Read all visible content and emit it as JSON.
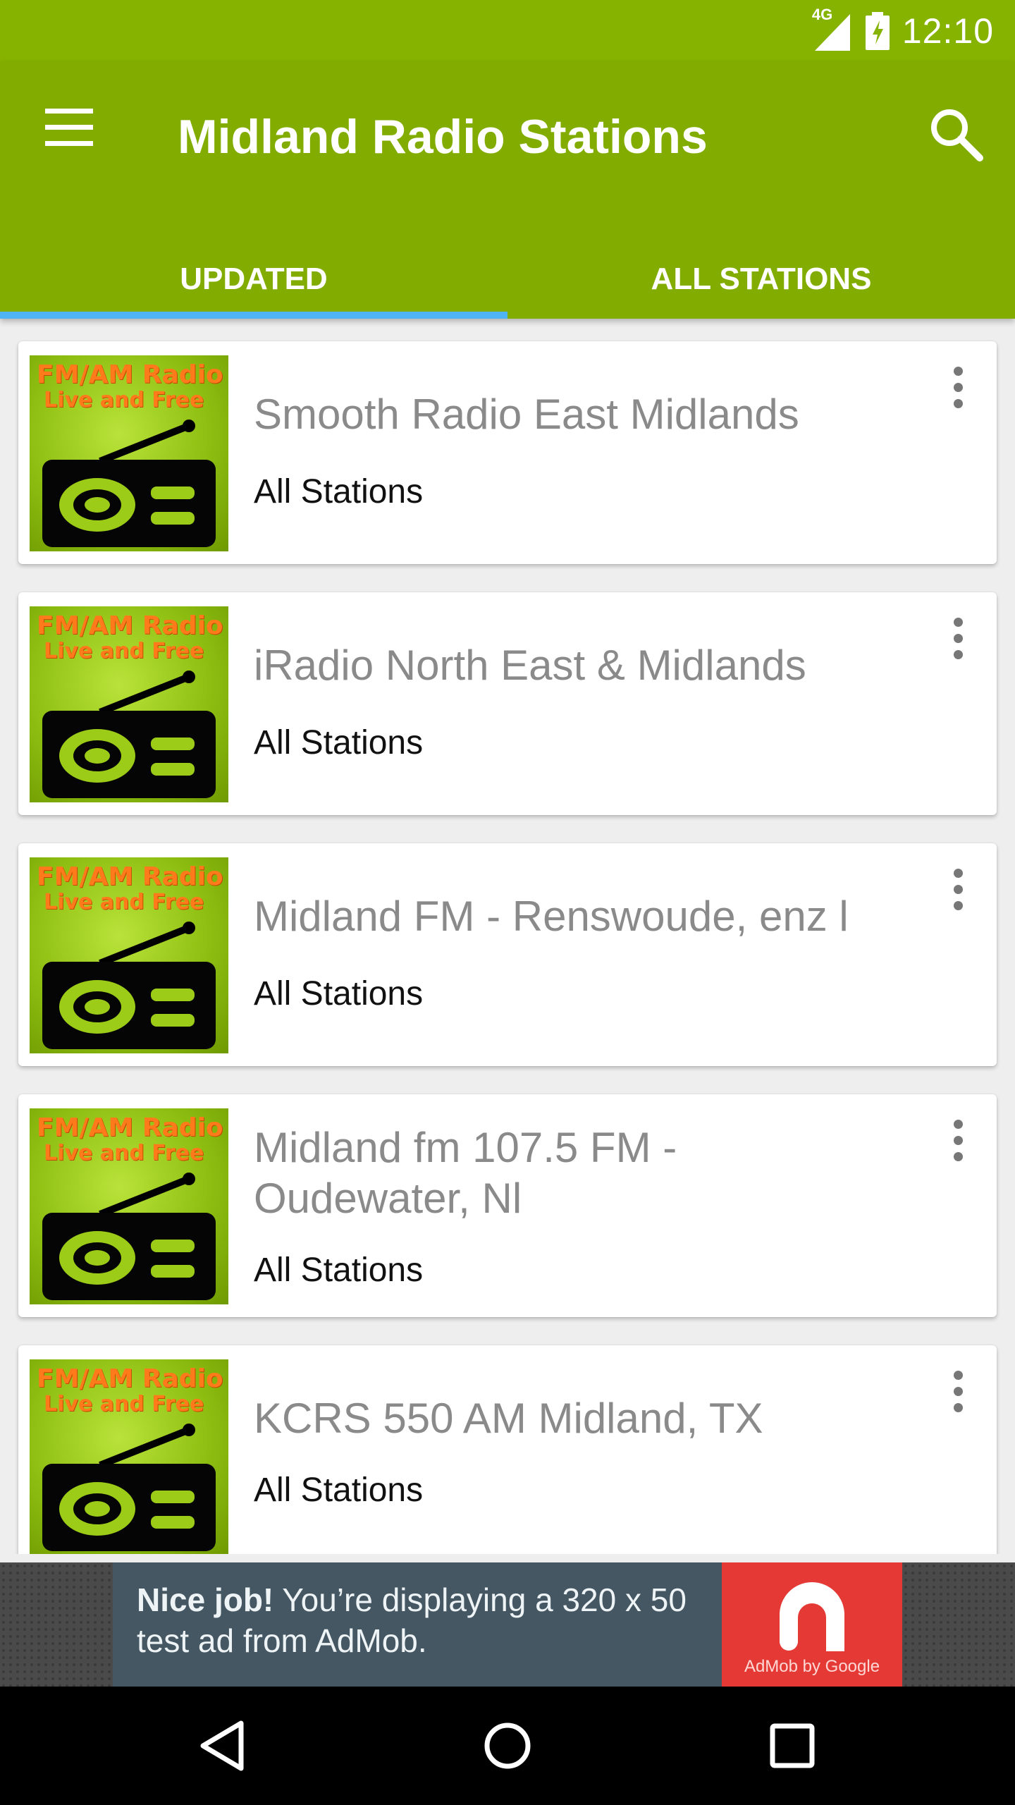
{
  "status_bar": {
    "network": "4G",
    "time": "12:10"
  },
  "app_bar": {
    "title": "Midland Radio Stations",
    "menu_icon": "hamburger-menu-icon",
    "search_icon": "search-icon",
    "background_color": "#82ad00",
    "accent_color": "#4fb4f4"
  },
  "tabs": [
    {
      "label": "UPDATED",
      "selected": true
    },
    {
      "label": "ALL STATIONS",
      "selected": false
    }
  ],
  "stations": [
    {
      "title": "Smooth Radio East Midlands",
      "subtitle": "All Stations",
      "thumb_line1": "FM/AM Radio",
      "thumb_line2": "Live and Free"
    },
    {
      "title": "iRadio North East & Midlands",
      "subtitle": "All Stations",
      "thumb_line1": "FM/AM Radio",
      "thumb_line2": "Live and Free"
    },
    {
      "title": "Midland FM - Renswoude, enz l",
      "subtitle": "All Stations",
      "thumb_line1": "FM/AM Radio",
      "thumb_line2": "Live and Free"
    },
    {
      "title": "Midland fm 107.5 FM - Oudewater, Nl",
      "subtitle": "All Stations",
      "thumb_line1": "FM/AM Radio",
      "thumb_line2": "Live and Free"
    },
    {
      "title": "KCRS 550 AM Midland, TX",
      "subtitle": "All Stations",
      "thumb_line1": "FM/AM Radio",
      "thumb_line2": "Live and Free"
    }
  ],
  "ad": {
    "bold": "Nice job!",
    "text": " You’re displaying a 320 x 50 test ad from AdMob.",
    "logo_caption": "AdMob by Google"
  },
  "nav_bar": {
    "back_icon": "back-triangle-icon",
    "home_icon": "home-circle-icon",
    "recents_icon": "recents-square-icon"
  }
}
